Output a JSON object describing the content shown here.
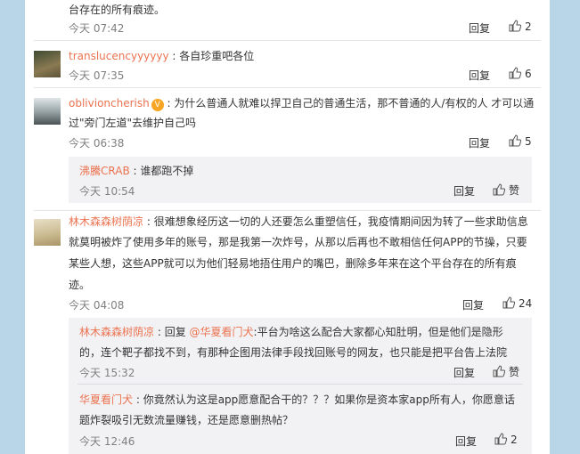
{
  "ui": {
    "reply_label": "回复",
    "thumb_icon": "thumbs-up-icon"
  },
  "comments": [
    {
      "text": "台存在的所有痕迹。",
      "time": "今天 07:42",
      "likes": "2"
    },
    {
      "user": "translucencyyyyyy",
      "text": "各自珍重吧各位",
      "time": "今天 07:35",
      "likes": "6"
    },
    {
      "user": "oblivioncherish",
      "text1": "为什么普通人就难以捍卫自己的普通生活，那不普通的人/有权的人 才可以通",
      "text2": "过\"旁门左道\"去维护自己吗",
      "time": "今天 06:38",
      "likes": "5",
      "replies": [
        {
          "user": "沸騰CRAB",
          "text": "谁都跑不掉",
          "time": "今天 10:54",
          "likes": "赞"
        }
      ]
    },
    {
      "user": "林木森森树荫凉",
      "lines": [
        "很难想象经历这一切的人还要怎么重塑信任，我疫情期间因为转了一些求助信息",
        "就莫明被炸了使用多年的账号，那是我第一次炸号，从那以后再也不敢相信任何APP的节操，只要",
        "某些人想，这些APP就可以为他们轻易地捂住用户的嘴巴，删除多年来在这个平台存在的所有痕",
        "迹。"
      ],
      "time": "今天 04:08",
      "likes": "24",
      "replies": [
        {
          "user": "林木森森树荫凉",
          "prefix": "回复 ",
          "mention": "@华夏看门犬",
          "line1": ":平台为啥这么配合大家都心知肚明，但是他们是隐形",
          "line2": "的，连个靶子都找不到，有那种企图用法律手段找回账号的网友，也只能是把平台告上法院",
          "time": "今天 15:32",
          "likes": "赞"
        },
        {
          "user": "华夏看门犬",
          "line1": "你竟然认为这是app愿意配合干的？？？如果你是资本家app所有人，你愿意话",
          "line2": "题炸裂吸引无数流量赚钱，还是愿意删热帖？",
          "time": "今天 12:46",
          "likes": "2"
        }
      ]
    }
  ]
}
